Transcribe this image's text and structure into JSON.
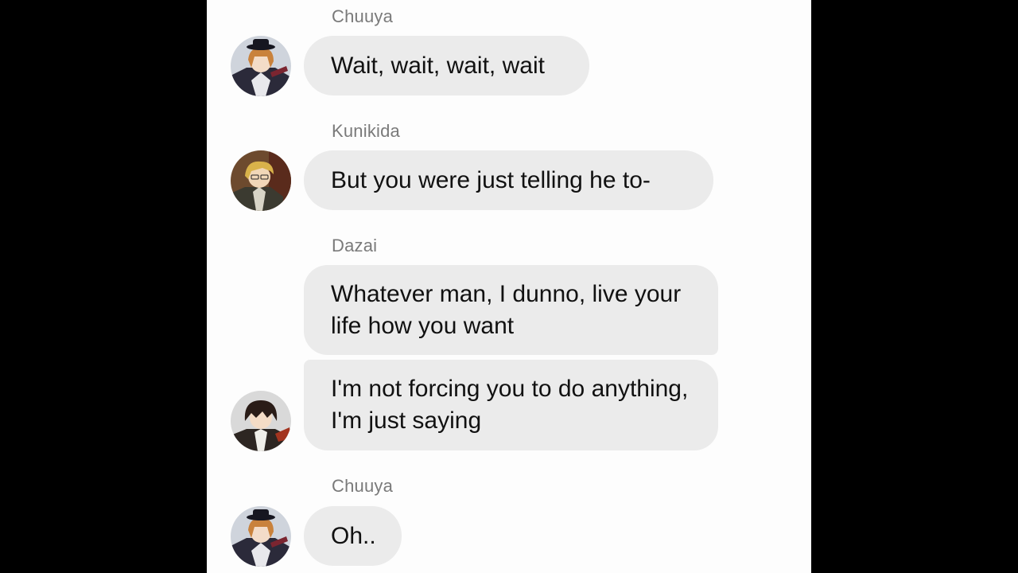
{
  "colors": {
    "frame_background": "#000000",
    "chat_background": "#fdfdfd",
    "bubble_background": "#ebebeb",
    "bubble_text": "#111111",
    "sender_name_text": "#7a7a7a"
  },
  "messages": [
    {
      "sender": "Chuuya",
      "avatar": "chuuya-avatar",
      "bubbles": [
        "Wait, wait, wait, wait"
      ]
    },
    {
      "sender": "Kunikida",
      "avatar": "kunikida-avatar",
      "bubbles": [
        "But you were just telling he to-"
      ]
    },
    {
      "sender": "Dazai",
      "avatar": "dazai-avatar",
      "bubbles": [
        "Whatever man, I dunno, live your life how you want",
        "I'm not forcing you to do anything, I'm just saying"
      ]
    },
    {
      "sender": "Chuuya",
      "avatar": "chuuya-avatar",
      "bubbles": [
        "Oh.."
      ]
    }
  ]
}
